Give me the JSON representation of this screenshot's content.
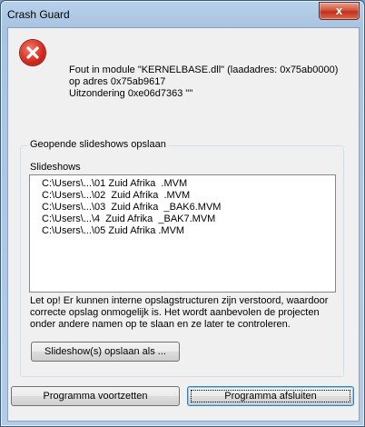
{
  "window": {
    "title": "Crash Guard",
    "close_glyph": "x"
  },
  "error": {
    "icon": "error-x-circle-icon",
    "lines": [
      "Fout in module \"KERNELBASE.dll\" (laadadres: 0x75ab0000)",
      "op adres 0x75ab9617",
      "Uitzondering 0xe06d7363 \"\""
    ]
  },
  "group": {
    "title": "Geopende slideshows opslaan",
    "list_label": "Slideshows",
    "items": [
      "C:\\Users\\...\\01 Zuid Afrika  .MVM",
      "C:\\Users\\...\\02  Zuid Afrika  .MVM",
      "C:\\Users\\...\\03  Zuid Afrika  _BAK6.MVM",
      "C:\\Users\\...\\4  Zuid Afrika  _BAK7.MVM",
      "C:\\Users\\...\\05 Zuid Afrika .MVM"
    ],
    "warning_lines": [
      "Let op! Er kunnen interne opslagstructuren zijn verstoord, waardoor",
      "correcte opslag onmogelijk is. Het wordt aanbevolen de projecten",
      "onder andere namen op te slaan en ze later te controleren."
    ],
    "save_button": "Slideshow(s) opslaan als ..."
  },
  "buttons": {
    "continue": "Programma voortzetten",
    "close": "Programma afsluiten"
  },
  "colors": {
    "title_bar": "#b9d1ea",
    "close_button": "#c2301a",
    "error_icon": "#d3281b",
    "client_bg": "#f0f0f0"
  }
}
